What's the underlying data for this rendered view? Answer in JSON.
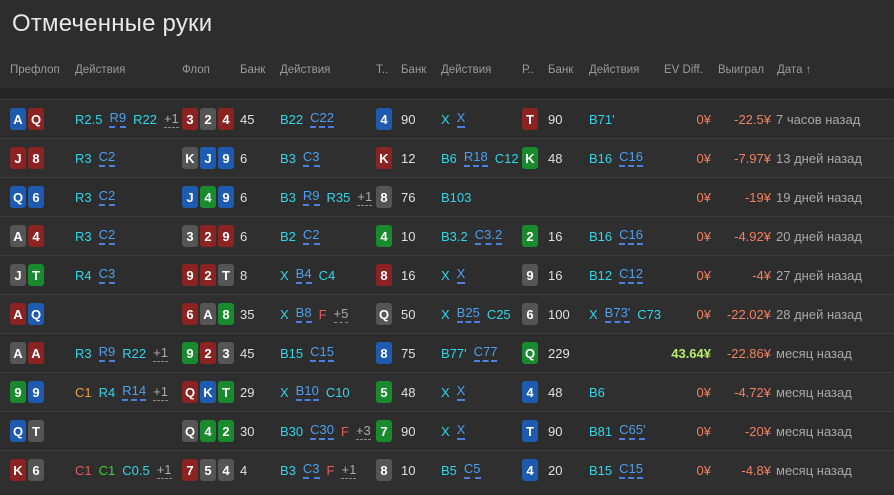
{
  "title": "Отмеченные руки",
  "headers": {
    "preflop": "Префлоп",
    "preflop_actions": "Действия",
    "flop": "Флоп",
    "bank1": "Банк",
    "flop_actions": "Действия",
    "turn": "Т..",
    "bank2": "Банк",
    "turn_actions": "Действия",
    "river": "Р..",
    "bank3": "Банк",
    "river_actions": "Действия",
    "ev": "EV Diff.",
    "won": "Выиграл",
    "date": "Дата ↑"
  },
  "colors": {
    "heart": "#8b2323",
    "diamond": "#1e5bb0",
    "club": "#198a2e",
    "spade": "#555555"
  },
  "rows": [
    {
      "hand": [
        {
          "r": "A",
          "s": "d"
        },
        {
          "r": "Q",
          "s": "h"
        }
      ],
      "pre": [
        {
          "t": "R2.5",
          "k": "cyan"
        },
        {
          "t": "R9",
          "k": "blue"
        },
        {
          "t": "R22",
          "k": "cyan"
        },
        {
          "t": "+1",
          "k": "more"
        }
      ],
      "flop": [
        {
          "r": "3",
          "s": "h"
        },
        {
          "r": "2",
          "s": "s"
        },
        {
          "r": "4",
          "s": "h"
        }
      ],
      "b1": "45",
      "fa": [
        {
          "t": "B22",
          "k": "cyan"
        },
        {
          "t": "C22",
          "k": "blue"
        }
      ],
      "turn": {
        "r": "4",
        "s": "d"
      },
      "b2": "90",
      "ta": [
        {
          "t": "X",
          "k": "cyan"
        },
        {
          "t": "X",
          "k": "blue"
        }
      ],
      "river": {
        "r": "T",
        "s": "h"
      },
      "b3": "90",
      "ra": [
        {
          "t": "B71'",
          "k": "cyan"
        }
      ],
      "ev": "0¥",
      "won": "-22.5¥",
      "date": "7 часов назад"
    },
    {
      "hand": [
        {
          "r": "J",
          "s": "h"
        },
        {
          "r": "8",
          "s": "h"
        }
      ],
      "pre": [
        {
          "t": "R3",
          "k": "cyan"
        },
        {
          "t": "C2",
          "k": "blue"
        }
      ],
      "flop": [
        {
          "r": "K",
          "s": "s"
        },
        {
          "r": "J",
          "s": "d"
        },
        {
          "r": "9",
          "s": "d"
        }
      ],
      "b1": "6",
      "fa": [
        {
          "t": "B3",
          "k": "cyan"
        },
        {
          "t": "C3",
          "k": "blue"
        }
      ],
      "turn": {
        "r": "K",
        "s": "h"
      },
      "b2": "12",
      "ta": [
        {
          "t": "B6",
          "k": "cyan"
        },
        {
          "t": "R18",
          "k": "blue"
        },
        {
          "t": "C12",
          "k": "cyan"
        }
      ],
      "river": {
        "r": "K",
        "s": "c"
      },
      "b3": "48",
      "ra": [
        {
          "t": "B16",
          "k": "cyan"
        },
        {
          "t": "C16",
          "k": "blue"
        }
      ],
      "ev": "0¥",
      "won": "-7.97¥",
      "date": "13 дней назад"
    },
    {
      "hand": [
        {
          "r": "Q",
          "s": "d"
        },
        {
          "r": "6",
          "s": "d"
        }
      ],
      "pre": [
        {
          "t": "R3",
          "k": "cyan"
        },
        {
          "t": "C2",
          "k": "blue"
        }
      ],
      "flop": [
        {
          "r": "J",
          "s": "d"
        },
        {
          "r": "4",
          "s": "c"
        },
        {
          "r": "9",
          "s": "d"
        }
      ],
      "b1": "6",
      "fa": [
        {
          "t": "B3",
          "k": "cyan"
        },
        {
          "t": "R9",
          "k": "blue"
        },
        {
          "t": "R35",
          "k": "cyan"
        },
        {
          "t": "+1",
          "k": "more"
        }
      ],
      "turn": {
        "r": "8",
        "s": "s"
      },
      "b2": "76",
      "ta": [
        {
          "t": "B103",
          "k": "cyan"
        }
      ],
      "river": null,
      "b3": "",
      "ra": [],
      "ev": "0¥",
      "won": "-19¥",
      "date": "19 дней назад"
    },
    {
      "hand": [
        {
          "r": "A",
          "s": "s"
        },
        {
          "r": "4",
          "s": "h"
        }
      ],
      "pre": [
        {
          "t": "R3",
          "k": "cyan"
        },
        {
          "t": "C2",
          "k": "blue"
        }
      ],
      "flop": [
        {
          "r": "3",
          "s": "s"
        },
        {
          "r": "2",
          "s": "h"
        },
        {
          "r": "9",
          "s": "h"
        }
      ],
      "b1": "6",
      "fa": [
        {
          "t": "B2",
          "k": "cyan"
        },
        {
          "t": "C2",
          "k": "blue"
        }
      ],
      "turn": {
        "r": "4",
        "s": "c"
      },
      "b2": "10",
      "ta": [
        {
          "t": "B3.2",
          "k": "cyan"
        },
        {
          "t": "C3.2",
          "k": "blue"
        }
      ],
      "river": {
        "r": "2",
        "s": "c"
      },
      "b3": "16",
      "ra": [
        {
          "t": "B16",
          "k": "cyan"
        },
        {
          "t": "C16",
          "k": "blue"
        }
      ],
      "ev": "0¥",
      "won": "-4.92¥",
      "date": "20 дней назад"
    },
    {
      "hand": [
        {
          "r": "J",
          "s": "s"
        },
        {
          "r": "T",
          "s": "c"
        }
      ],
      "pre": [
        {
          "t": "R4",
          "k": "cyan"
        },
        {
          "t": "C3",
          "k": "blue"
        }
      ],
      "flop": [
        {
          "r": "9",
          "s": "h"
        },
        {
          "r": "2",
          "s": "h"
        },
        {
          "r": "T",
          "s": "s"
        }
      ],
      "b1": "8",
      "fa": [
        {
          "t": "X",
          "k": "cyan"
        },
        {
          "t": "B4",
          "k": "blue"
        },
        {
          "t": "C4",
          "k": "cyan"
        }
      ],
      "turn": {
        "r": "8",
        "s": "h"
      },
      "b2": "16",
      "ta": [
        {
          "t": "X",
          "k": "cyan"
        },
        {
          "t": "X",
          "k": "blue"
        }
      ],
      "river": {
        "r": "9",
        "s": "s"
      },
      "b3": "16",
      "ra": [
        {
          "t": "B12",
          "k": "cyan"
        },
        {
          "t": "C12",
          "k": "blue"
        }
      ],
      "ev": "0¥",
      "won": "-4¥",
      "date": "27 дней назад"
    },
    {
      "hand": [
        {
          "r": "A",
          "s": "h"
        },
        {
          "r": "Q",
          "s": "d"
        }
      ],
      "pre": [],
      "flop": [
        {
          "r": "6",
          "s": "h"
        },
        {
          "r": "A",
          "s": "s"
        },
        {
          "r": "8",
          "s": "c"
        }
      ],
      "b1": "35",
      "fa": [
        {
          "t": "X",
          "k": "cyan"
        },
        {
          "t": "B8",
          "k": "blue"
        },
        {
          "t": "F",
          "k": "red"
        },
        {
          "t": "+5",
          "k": "more"
        }
      ],
      "turn": {
        "r": "Q",
        "s": "s"
      },
      "b2": "50",
      "ta": [
        {
          "t": "X",
          "k": "cyan"
        },
        {
          "t": "B25",
          "k": "blue"
        },
        {
          "t": "C25",
          "k": "cyan"
        }
      ],
      "river": {
        "r": "6",
        "s": "s"
      },
      "b3": "100",
      "ra": [
        {
          "t": "X",
          "k": "cyan"
        },
        {
          "t": "B73'",
          "k": "blue"
        },
        {
          "t": "C73",
          "k": "cyan"
        }
      ],
      "ev": "0¥",
      "won": "-22.02¥",
      "date": "28 дней назад"
    },
    {
      "hand": [
        {
          "r": "A",
          "s": "s"
        },
        {
          "r": "A",
          "s": "h"
        }
      ],
      "pre": [
        {
          "t": "R3",
          "k": "cyan"
        },
        {
          "t": "R9",
          "k": "blue"
        },
        {
          "t": "R22",
          "k": "cyan"
        },
        {
          "t": "+1",
          "k": "more"
        }
      ],
      "flop": [
        {
          "r": "9",
          "s": "c"
        },
        {
          "r": "2",
          "s": "h"
        },
        {
          "r": "3",
          "s": "s"
        }
      ],
      "b1": "45",
      "fa": [
        {
          "t": "B15",
          "k": "cyan"
        },
        {
          "t": "C15",
          "k": "blue"
        }
      ],
      "turn": {
        "r": "8",
        "s": "d"
      },
      "b2": "75",
      "ta": [
        {
          "t": "B77'",
          "k": "cyan"
        },
        {
          "t": "C77",
          "k": "blue"
        }
      ],
      "river": {
        "r": "Q",
        "s": "c"
      },
      "b3": "229",
      "ra": [],
      "ev": "43.64¥",
      "evpos": true,
      "won": "-22.86¥",
      "date": "месяц назад"
    },
    {
      "hand": [
        {
          "r": "9",
          "s": "c"
        },
        {
          "r": "9",
          "s": "d"
        }
      ],
      "pre": [
        {
          "t": "C1",
          "k": "orange"
        },
        {
          "t": "R4",
          "k": "cyan"
        },
        {
          "t": "R14",
          "k": "blue"
        },
        {
          "t": "+1",
          "k": "more"
        }
      ],
      "flop": [
        {
          "r": "Q",
          "s": "h"
        },
        {
          "r": "K",
          "s": "d"
        },
        {
          "r": "T",
          "s": "c"
        }
      ],
      "b1": "29",
      "fa": [
        {
          "t": "X",
          "k": "cyan"
        },
        {
          "t": "B10",
          "k": "blue"
        },
        {
          "t": "C10",
          "k": "cyan"
        }
      ],
      "turn": {
        "r": "5",
        "s": "c"
      },
      "b2": "48",
      "ta": [
        {
          "t": "X",
          "k": "cyan"
        },
        {
          "t": "X",
          "k": "blue"
        }
      ],
      "river": {
        "r": "4",
        "s": "d"
      },
      "b3": "48",
      "ra": [
        {
          "t": "B6",
          "k": "cyan"
        }
      ],
      "ev": "0¥",
      "won": "-4.72¥",
      "date": "месяц назад"
    },
    {
      "hand": [
        {
          "r": "Q",
          "s": "d"
        },
        {
          "r": "T",
          "s": "s"
        }
      ],
      "pre": [],
      "flop": [
        {
          "r": "Q",
          "s": "s"
        },
        {
          "r": "4",
          "s": "c"
        },
        {
          "r": "2",
          "s": "c"
        }
      ],
      "b1": "30",
      "fa": [
        {
          "t": "B30",
          "k": "cyan"
        },
        {
          "t": "C30",
          "k": "blue"
        },
        {
          "t": "F",
          "k": "red"
        },
        {
          "t": "+3",
          "k": "more"
        }
      ],
      "turn": {
        "r": "7",
        "s": "c"
      },
      "b2": "90",
      "ta": [
        {
          "t": "X",
          "k": "cyan"
        },
        {
          "t": "X",
          "k": "blue"
        }
      ],
      "river": {
        "r": "T",
        "s": "d"
      },
      "b3": "90",
      "ra": [
        {
          "t": "B81",
          "k": "cyan"
        },
        {
          "t": "C65'",
          "k": "blue"
        }
      ],
      "ev": "0¥",
      "won": "-20¥",
      "date": "месяц назад"
    },
    {
      "hand": [
        {
          "r": "K",
          "s": "h"
        },
        {
          "r": "6",
          "s": "s"
        }
      ],
      "pre": [
        {
          "t": "C1",
          "k": "red"
        },
        {
          "t": "C1",
          "k": "green"
        },
        {
          "t": "C0.5",
          "k": "cyan"
        },
        {
          "t": "+1",
          "k": "more"
        }
      ],
      "flop": [
        {
          "r": "7",
          "s": "h"
        },
        {
          "r": "5",
          "s": "s"
        },
        {
          "r": "4",
          "s": "s"
        }
      ],
      "b1": "4",
      "fa": [
        {
          "t": "B3",
          "k": "cyan"
        },
        {
          "t": "C3",
          "k": "blue"
        },
        {
          "t": "F",
          "k": "red"
        },
        {
          "t": "+1",
          "k": "more"
        }
      ],
      "turn": {
        "r": "8",
        "s": "s"
      },
      "b2": "10",
      "ta": [
        {
          "t": "B5",
          "k": "cyan"
        },
        {
          "t": "C5",
          "k": "blue"
        }
      ],
      "river": {
        "r": "4",
        "s": "d"
      },
      "b3": "20",
      "ra": [
        {
          "t": "B15",
          "k": "cyan"
        },
        {
          "t": "C15",
          "k": "blue"
        }
      ],
      "ev": "0¥",
      "won": "-4.8¥",
      "date": "месяц назад"
    }
  ]
}
